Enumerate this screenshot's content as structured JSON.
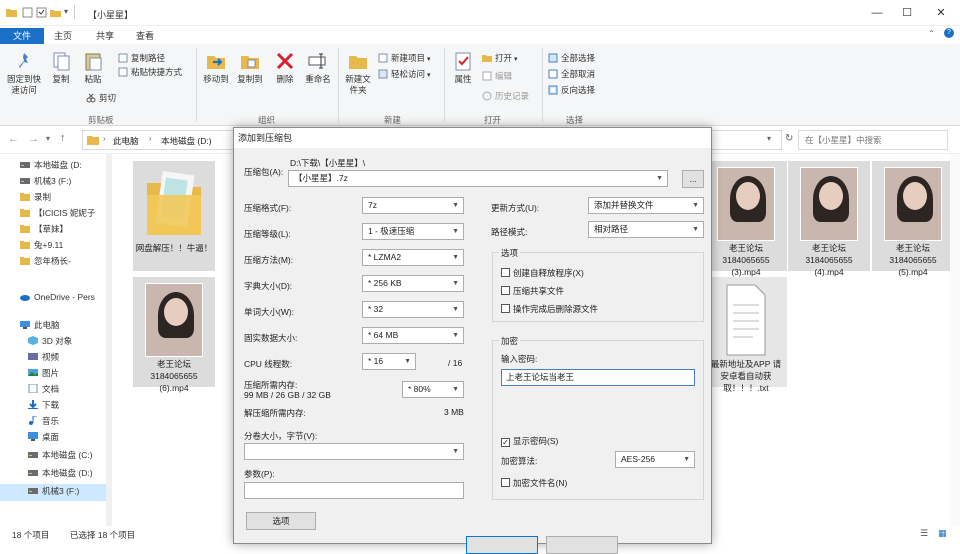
{
  "window": {
    "title": "【小星星】"
  },
  "ribbon_tabs": [
    "文件",
    "主页",
    "共享",
    "查看"
  ],
  "ribbon": {
    "pin": "固定到快速访问",
    "copy": "复制",
    "paste": "粘贴",
    "copy_path": "复制路径",
    "paste_shortcut": "粘贴快捷方式",
    "cut": "剪切",
    "clipboard": "剪贴板",
    "move_to": "移动到",
    "copy_to": "复制到",
    "delete": "删除",
    "rename": "重命名",
    "organize": "组织",
    "new_folder": "新建文件夹",
    "new_item": "新建项目",
    "easy_access": "轻松访问",
    "new_group": "新建",
    "properties": "属性",
    "open": "打开",
    "edit": "编辑",
    "history": "历史记录",
    "open_group": "打开",
    "select_all": "全部选择",
    "select_none": "全部取消",
    "invert": "反向选择",
    "select_group": "选择"
  },
  "address": {
    "crumbs": [
      "此电脑",
      "本地磁盘 (D:)"
    ],
    "search_placeholder": "在【小星星】中搜索"
  },
  "nav": [
    {
      "label": "本地磁盘 (D:",
      "icon": "drive-icon"
    },
    {
      "label": "机械3 (F:)",
      "icon": "drive-icon"
    },
    {
      "label": "录制",
      "icon": "folder-icon"
    },
    {
      "label": "【ICICIS 妮妮子",
      "icon": "folder-icon"
    },
    {
      "label": "【草妹】",
      "icon": "folder-icon"
    },
    {
      "label": "兔+9.11",
      "icon": "folder-icon"
    },
    {
      "label": "忽年杨长-",
      "icon": "folder-icon"
    },
    {
      "label": "OneDrive - Pers",
      "icon": "cloud-icon"
    },
    {
      "label": "此电脑",
      "icon": "pc-icon"
    },
    {
      "label": "3D 对象",
      "icon": "cube-icon"
    },
    {
      "label": "视频",
      "icon": "video-icon"
    },
    {
      "label": "图片",
      "icon": "picture-icon"
    },
    {
      "label": "文档",
      "icon": "document-icon"
    },
    {
      "label": "下载",
      "icon": "download-icon"
    },
    {
      "label": "音乐",
      "icon": "music-icon"
    },
    {
      "label": "桌面",
      "icon": "desktop-icon"
    },
    {
      "label": "本地磁盘 (C:)",
      "icon": "drive-icon"
    },
    {
      "label": "本地磁盘 (D:)",
      "icon": "drive-icon"
    },
    {
      "label": "机械3 (F:)",
      "icon": "drive-icon"
    }
  ],
  "files": [
    {
      "name": "网盘解压！！牛逼！",
      "type": "folder"
    },
    {
      "name": "老王论坛 3184065655 (3).mp4",
      "type": "video"
    },
    {
      "name": "老王论坛 3184065655 (4).mp4",
      "type": "video"
    },
    {
      "name": "老王论坛 3184065655 (5).mp4",
      "type": "video"
    },
    {
      "name": "老王论坛 3184065655 (6).mp4",
      "type": "video"
    },
    {
      "name": "最新地址及APP 请安卓看自动获取！！！.txt",
      "type": "text"
    }
  ],
  "status": {
    "count": "18 个项目",
    "selected": "已选择 18 个项目"
  },
  "dialog": {
    "title": "添加到压缩包",
    "archive_label": "压缩包(A):",
    "archive_path": "D:\\下载\\【小星星】\\",
    "archive_name": "【小星星】.7z",
    "browse": "...",
    "format_label": "压缩格式(F):",
    "format_value": "7z",
    "level_label": "压缩等级(L):",
    "level_value": "1 - 极速压缩",
    "method_label": "压缩方法(M):",
    "method_value": "* LZMA2",
    "dict_label": "字典大小(D):",
    "dict_value": "* 256 KB",
    "word_label": "单词大小(W):",
    "word_value": "* 32",
    "solid_label": "固实数据大小:",
    "solid_value": "* 64 MB",
    "cpu_label": "CPU 线程数:",
    "cpu_value": "* 16",
    "cpu_max": "/ 16",
    "mem_label": "压缩所需内存:",
    "mem_value": "99 MB / 26 GB / 32 GB",
    "mem_pct": "* 80%",
    "decomp_label": "解压缩所需内存:",
    "decomp_value": "3 MB",
    "split_label": "分卷大小，字节(V):",
    "params_label": "参数(P):",
    "options_btn": "选项",
    "update_label": "更新方式(U):",
    "update_value": "添加并替换文件",
    "pathmode_label": "路径模式:",
    "pathmode_value": "相对路径",
    "options_legend": "选项",
    "opt_sfx": "创建自释放程序(X)",
    "opt_shared": "压缩共享文件",
    "opt_delete": "操作完成后删除源文件",
    "enc_legend": "加密",
    "pwd_label": "输入密码:",
    "pwd_value": "上老王论坛当老王",
    "show_pwd": "显示密码(S)",
    "enc_method_label": "加密算法:",
    "enc_method_value": "AES-256",
    "enc_names": "加密文件名(N)"
  }
}
